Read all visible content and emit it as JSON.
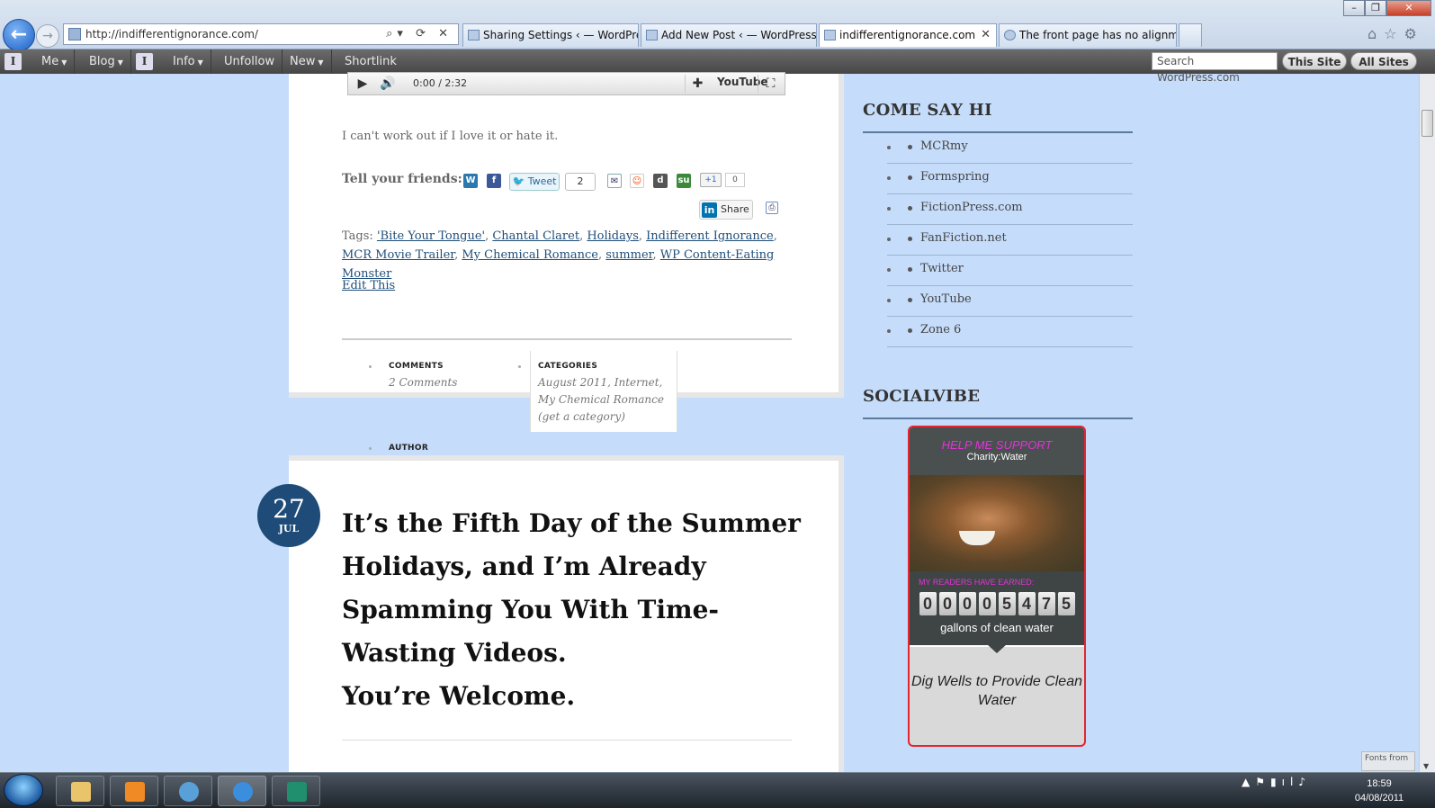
{
  "browser": {
    "address": "http://indifferentignorance.com/",
    "tabs": [
      {
        "label": "Sharing Settings ‹ — WordPress"
      },
      {
        "label": "Add New Post ‹ — WordPress"
      },
      {
        "label": "indifferentignorance.com",
        "active": true
      },
      {
        "label": "The front page has no alignme..."
      }
    ]
  },
  "adminbar": {
    "me": "Me",
    "blog": "Blog",
    "info": "Info",
    "unfollow": "Unfollow",
    "new": "New",
    "shortlink": "Shortlink",
    "search_placeholder": "Search WordPress.com",
    "this_site": "This Site",
    "all_sites": "All Sites"
  },
  "player": {
    "time": "0:00 / 2:32",
    "youtube": "YouTube"
  },
  "post1": {
    "text": "I can't work out if I love it or hate it.",
    "tell_friends": "Tell your friends:",
    "tweet": "Tweet",
    "tweet_count": "2",
    "plusone": "+1",
    "plusone_count": "0",
    "linkedin": "Share",
    "tags_label": "Tags:",
    "tags": [
      "'Bite Your Tongue'",
      "Chantal Claret",
      "Holidays",
      "Indifferent Ignorance",
      "MCR Movie Trailer",
      "My Chemical Romance",
      "summer",
      "WP Content-Eating Monster"
    ],
    "edit": "Edit This",
    "meta": {
      "comments_label": "COMMENTS",
      "comments_value": "2 Comments",
      "categories_label": "CATEGORIES",
      "categories_value": "August 2011, Internet, My Chemical Romance (get a category)",
      "author_label": "AUTHOR"
    }
  },
  "post2": {
    "day": "27",
    "month": "JUL",
    "title": "It’s the Fifth Day of the Summer Holidays, and I’m Already Spamming You With Time-Wasting Videos.",
    "subtitle": "You’re Welcome."
  },
  "sidebar": {
    "come_say_hi": "COME SAY HI",
    "links": [
      "MCRmy",
      "Formspring",
      "FictionPress.com",
      "FanFiction.net",
      "Twitter",
      "YouTube",
      "Zone 6"
    ],
    "socialvibe": "SOCIALVIBE",
    "widget": {
      "help": "HELP ME SUPPORT",
      "charity": "Charity:Water",
      "earned": "MY READERS HAVE EARNED:",
      "digits": [
        "0",
        "0",
        "0",
        "0",
        "5",
        "4",
        "7",
        "5"
      ],
      "gallons": "gallons of clean water",
      "cause": "Dig Wells to Provide Clean Water"
    }
  },
  "fonts_from": "Fonts from",
  "taskbar": {
    "time": "18:59",
    "date": "04/08/2011"
  },
  "colors": {
    "page_bg": "#c5dcfa",
    "date_badge": "#1e4b77",
    "link": "#1f4e79",
    "widget_border": "#e3262f",
    "widget_accent": "#e234d8"
  }
}
